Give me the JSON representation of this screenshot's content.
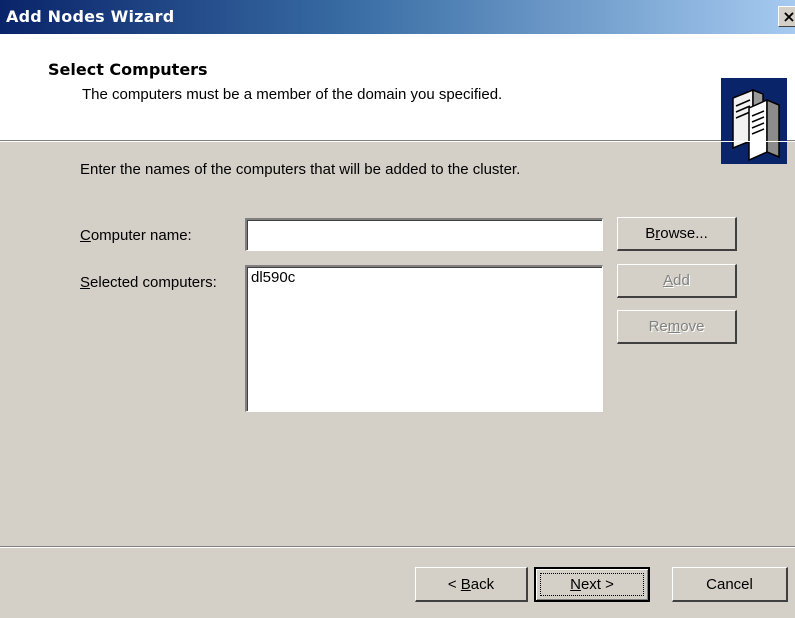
{
  "window": {
    "title": "Add Nodes Wizard",
    "close_glyph": "×"
  },
  "header": {
    "title": "Select Computers",
    "subtitle": "The computers must be a member of the domain you specified.",
    "icon": "servers-icon"
  },
  "instruction": "Enter the names of the computers that will be added to the cluster.",
  "form": {
    "computer_name": {
      "label_pre": "",
      "label_key": "C",
      "label_post": "omputer name:",
      "value": ""
    },
    "selected_computers": {
      "label_pre": "",
      "label_key": "S",
      "label_post": "elected computers:",
      "items": [
        "dl590c"
      ]
    }
  },
  "side_buttons": {
    "browse": {
      "pre": "B",
      "key": "r",
      "post": "owse..."
    },
    "add": {
      "pre": "",
      "key": "A",
      "post": "dd"
    },
    "remove": {
      "pre": "Re",
      "key": "m",
      "post": "ove"
    }
  },
  "footer": {
    "back": {
      "pre": "< ",
      "key": "B",
      "post": "ack"
    },
    "next": {
      "pre": "",
      "key": "N",
      "post": "ext >"
    },
    "cancel": "Cancel"
  },
  "colors": {
    "titlebar_start": "#0a246a",
    "titlebar_end": "#a6caf0",
    "dialog_bg": "#d4d0c8",
    "disabled_text": "#808080"
  }
}
